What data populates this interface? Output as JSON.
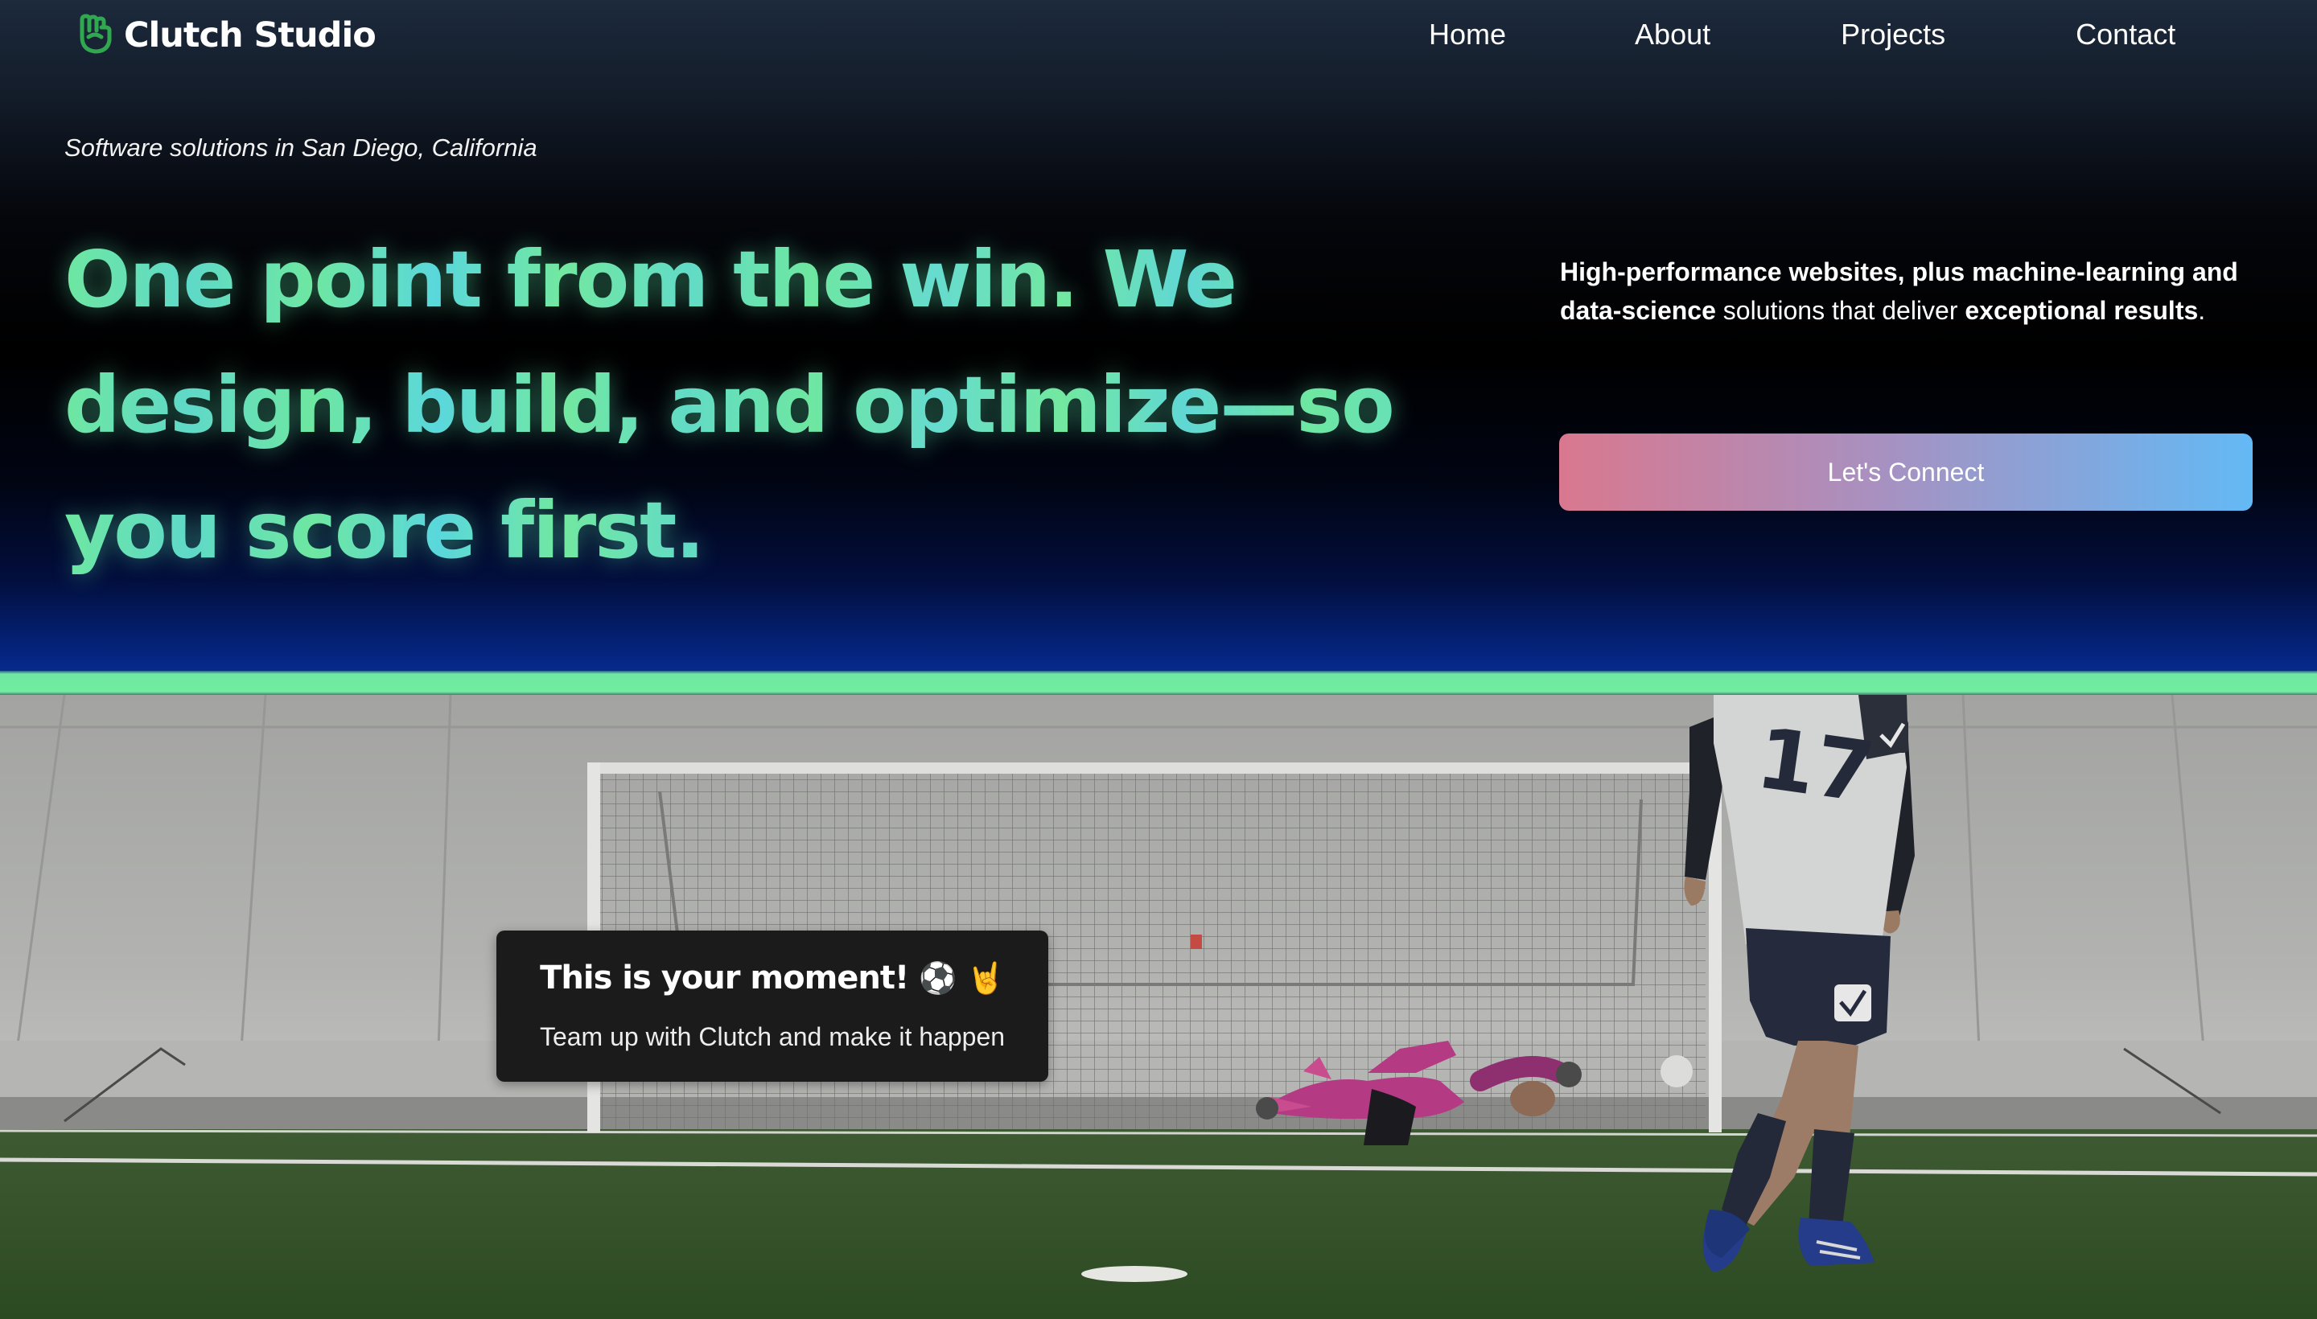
{
  "brand": {
    "name": "Clutch Studio",
    "logo_icon": "fist-logo-icon",
    "logo_color": "#2fa84f"
  },
  "nav": {
    "items": [
      {
        "label": "Home"
      },
      {
        "label": "About"
      },
      {
        "label": "Projects"
      },
      {
        "label": "Contact"
      }
    ]
  },
  "hero": {
    "tagline": "Software solutions in San Diego, California",
    "headline": "One point from the win. We design, build, and optimize—so you score first.",
    "headline_colors": [
      "#6ee7a1",
      "#5fd9d6"
    ],
    "description": {
      "part1": "High-performance websites, plus machine-learning and data-science",
      "part2": " solutions that deliver ",
      "part3": "exceptional results",
      "part4": "."
    },
    "cta_label": "Let's Connect",
    "cta_gradient": [
      "#d9788f",
      "#63b9f5"
    ]
  },
  "divider_color": "#6ee8a2",
  "card": {
    "title": "This is your moment!",
    "emoji": "⚽ 🤘",
    "subtitle": "Team up with Clutch and make it happen"
  },
  "scene": {
    "jersey_number": "17"
  }
}
